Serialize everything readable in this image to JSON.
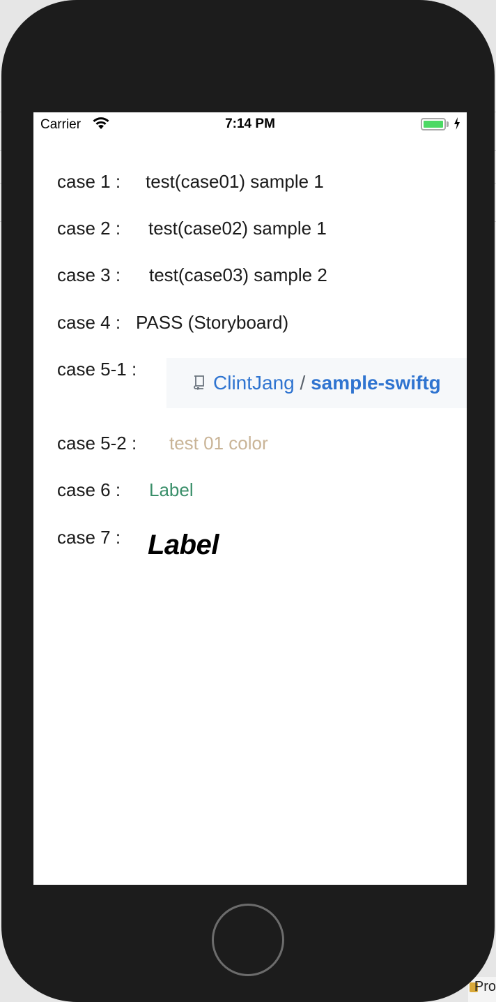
{
  "status_bar": {
    "carrier": "Carrier",
    "time": "7:14 PM",
    "wifi_icon": "wifi-icon",
    "battery_icon": "battery-icon",
    "charging_icon": "bolt-icon",
    "battery_color": "#4cd964"
  },
  "rows": [
    {
      "label": "case 1 :",
      "value": "test(case01) sample 1"
    },
    {
      "label": "case 2 :",
      "value": "test(case02) sample 1"
    },
    {
      "label": "case 3 :",
      "value": "test(case03) sample 2"
    },
    {
      "label": "case 4 :",
      "value": "PASS (Storyboard)"
    },
    {
      "label": "case 5-1 :",
      "repo_owner": "ClintJang",
      "repo_separator": "/",
      "repo_name": "sample-swiftg",
      "repo_icon": "repo-book-icon"
    },
    {
      "label": "case 5-2 :",
      "value": "test 01 color",
      "color": "#c9b497"
    },
    {
      "label": "case 6 :",
      "value": "Label",
      "color": "#3a8f6a"
    },
    {
      "label": "case 7 :",
      "value": "Label"
    }
  ],
  "background": {
    "corner_text": "Pro",
    "corner_icon": "folder-icon"
  },
  "device": {
    "home_button_icon": "home-button"
  }
}
